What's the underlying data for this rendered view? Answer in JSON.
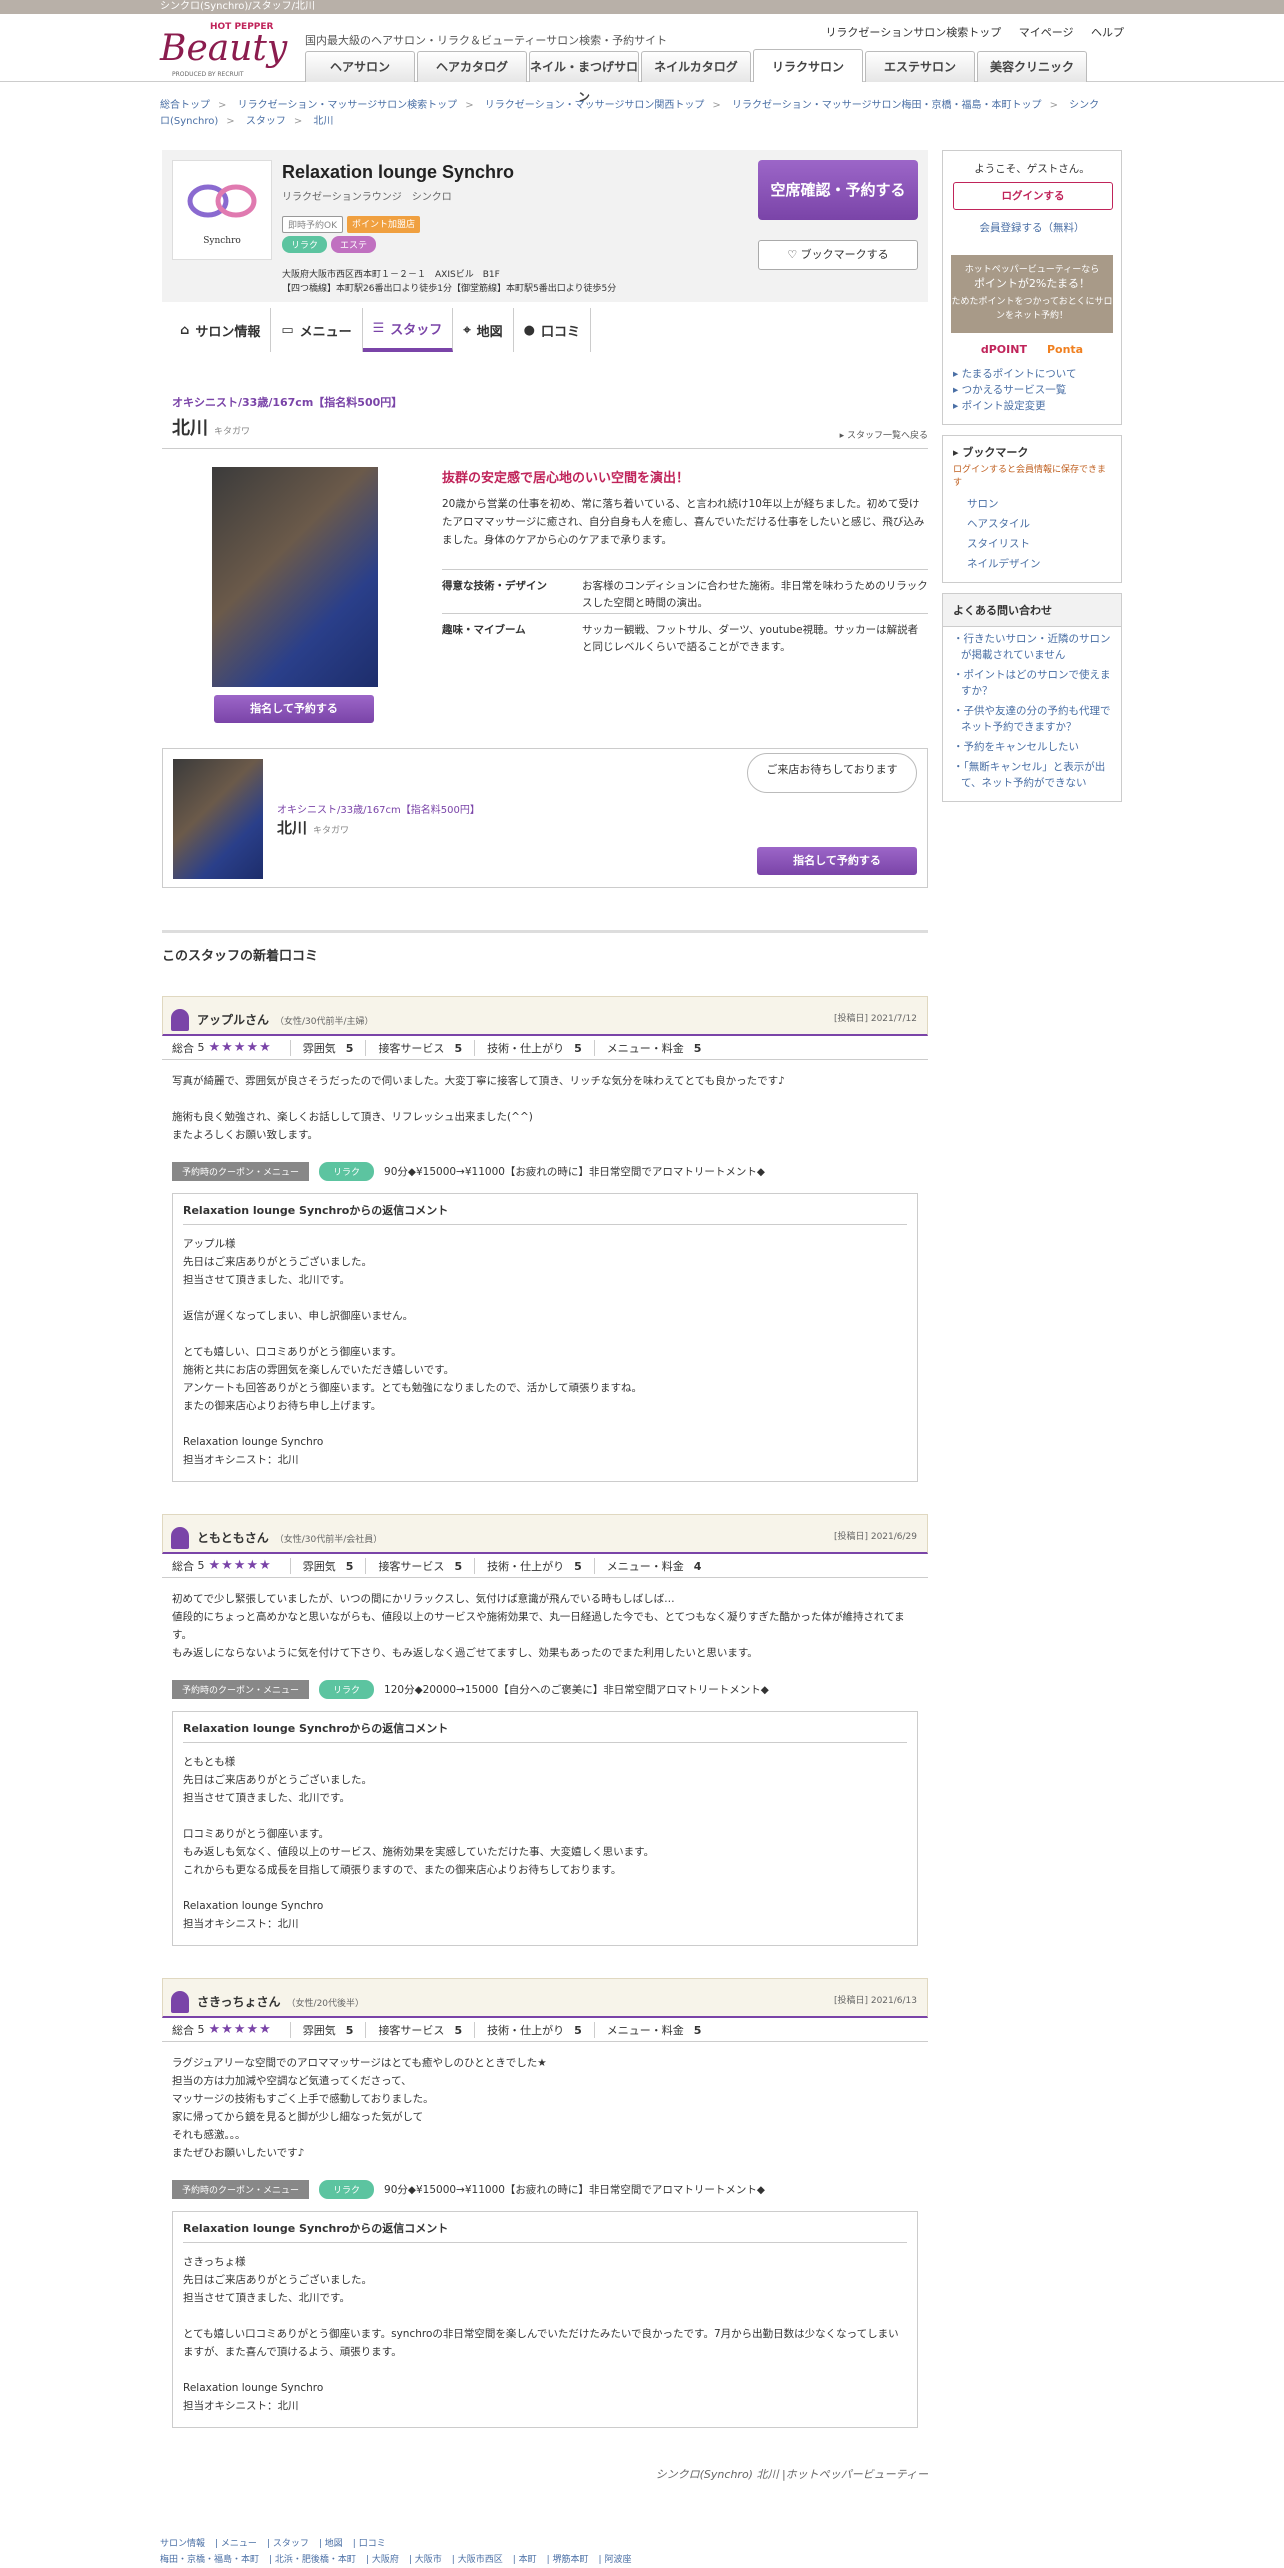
{
  "topstrip": "シンクロ(Synchro)/スタッフ/北川",
  "header": {
    "logo_hp": "HOT PEPPER",
    "logo_beauty": "Beauty",
    "logo_produced": "PRODUCED BY RECRUIT",
    "tagline": "国内最大級のヘアサロン・リラク＆ビューティーサロン検索・予約サイト",
    "links": [
      "リラクゼーションサロン検索トップ",
      "マイページ",
      "ヘルプ"
    ],
    "nav": [
      "ヘアサロン",
      "ヘアカタログ",
      "ネイル・まつげサロン",
      "ネイルカタログ",
      "リラクサロン",
      "エステサロン",
      "美容クリニック"
    ]
  },
  "breadcrumb": [
    "総合トップ",
    "リラクゼーション・マッサージサロン検索トップ",
    "リラクゼーション・マッサージサロン関西トップ",
    "リラクゼーション・マッサージサロン梅田・京橋・福島・本町トップ",
    "シンクロ(Synchro)",
    "スタッフ",
    "北川"
  ],
  "shop": {
    "name": "Relaxation lounge Synchro",
    "kana": "リラクゼーションラウンジ　シンクロ",
    "tags": [
      "即時予約OK",
      "ポイント加盟店",
      "リラク",
      "エステ"
    ],
    "addr1": "大阪府大阪市西区西本町１－２－１　AXISビル　B1F",
    "addr2": "【四つ橋線】本町駅26番出口より徒歩1分【御堂筋線】本町駅5番出口より徒歩5分",
    "reserve": "空席確認・予約する",
    "bookmark": "ブックマークする",
    "logo_text": "Synchro"
  },
  "tabs": [
    "サロン情報",
    "メニュー",
    "スタッフ",
    "地図",
    "口コミ"
  ],
  "staff": {
    "role": "オキシニスト/33歳/167cm【指名料500円】",
    "name": "北川",
    "kana": "キタガワ",
    "list_link": "スタッフ一覧へ戻る",
    "catch": "抜群の安定感で居心地のいい空間を演出！",
    "intro": "20歳から営業の仕事を初め、常に落ち着いている、と言われ続け10年以上が経ちました。初めて受けたアロママッサージに癒され、自分自身も人を癒し、喜んでいただける仕事をしたいと感じ、飛び込みました。身体のケアから心のケアまで承ります。",
    "spec1_label": "得意な技術・デザイン",
    "spec1": "お客様のコンディションに合わせた施術。非日常を味わうためのリラックスした空間と時間の演出。",
    "spec2_label": "趣味・マイブーム",
    "spec2": "サッカー観戦、フットサル、ダーツ、youtube視聴。サッカーは解説者と同じレベルくらいで語ることができます。",
    "btn": "指名して予約する",
    "bubble": "ご来店お待ちしております"
  },
  "reviews_title": "このスタッフの新着口コミ",
  "reviews": [
    {
      "name": "アップルさん",
      "meta": "（女性/30代前半/主婦）",
      "date": "[投稿日] 2021/7/12",
      "overall": "総合",
      "score": "5",
      "stars": "★★★★★",
      "r1": "雰囲気",
      "v1": "5",
      "r2": "接客サービス",
      "v2": "5",
      "r3": "技術・仕上がり",
      "v3": "5",
      "r4": "メニュー・料金",
      "v4": "5",
      "body": "写真が綺麗で、雰囲気が良さそうだったので伺いました。大変丁寧に接客して頂き、リッチな気分を味わえてとても良かったです♪\n\n施術も良く勉強され、楽しくお話しして頂き、リフレッシュ出来ました(^^)\nまたよろしくお願い致します。",
      "coupon_label": "予約時のクーポン・メニュー",
      "coupon_tag": "リラク",
      "coupon": "90分◆¥15000→¥11000【お疲れの時に】非日常空間でアロマトリートメント◆",
      "reply_title": "Relaxation lounge Synchroからの返信コメント",
      "reply": "アップル様\n先日はご来店ありがとうございました。\n担当させて頂きました、北川です。\n\n返信が遅くなってしまい、申し訳御座いません。\n\nとても嬉しい、口コミありがとう御座います。\n施術と共にお店の雰囲気を楽しんでいただき嬉しいです。\nアンケートも回答ありがとう御座います。とても勉強になりましたので、活かして頑張りますね。\nまたの御来店心よりお待ち申し上げます。\n\nRelaxation lounge Synchro\n担当オキシニスト：北川"
    },
    {
      "name": "ともともさん",
      "meta": "（女性/30代前半/会社員）",
      "date": "[投稿日] 2021/6/29",
      "overall": "総合",
      "score": "5",
      "stars": "★★★★★",
      "r1": "雰囲気",
      "v1": "5",
      "r2": "接客サービス",
      "v2": "5",
      "r3": "技術・仕上がり",
      "v3": "5",
      "r4": "メニュー・料金",
      "v4": "4",
      "body": "初めてで少し緊張していましたが、いつの間にかリラックスし、気付けば意識が飛んでいる時もしばしば…\n値段的にちょっと高めかなと思いながらも、値段以上のサービスや施術効果で、丸一日経過した今でも、とてつもなく凝りすぎた酷かった体が維持されてます。\nもみ返しにならないように気を付けて下さり、もみ返しなく過ごせてますし、効果もあったのでまた利用したいと思います。",
      "coupon_label": "予約時のクーポン・メニュー",
      "coupon_tag": "リラク",
      "coupon": "120分◆20000→15000【自分へのご褒美に】非日常空間アロマトリートメント◆",
      "reply_title": "Relaxation lounge Synchroからの返信コメント",
      "reply": "ともとも様\n先日はご来店ありがとうございました。\n担当させて頂きました、北川です。\n\n口コミありがとう御座います。\nもみ返しも気なく、値段以上のサービス、施術効果を実感していただけた事、大変嬉しく思います。\nこれからも更なる成長を目指して頑張りますので、またの御来店心よりお待ちしております。\n\nRelaxation lounge Synchro\n担当オキシニスト：北川"
    },
    {
      "name": "さきっちょさん",
      "meta": "（女性/20代後半）",
      "date": "[投稿日] 2021/6/13",
      "overall": "総合",
      "score": "5",
      "stars": "★★★★★",
      "r1": "雰囲気",
      "v1": "5",
      "r2": "接客サービス",
      "v2": "5",
      "r3": "技術・仕上がり",
      "v3": "5",
      "r4": "メニュー・料金",
      "v4": "5",
      "body": "ラグジュアリーな空間でのアロママッサージはとても癒やしのひとときでした★\n担当の方は力加減や空調など気遣ってくださって、\nマッサージの技術もすごく上手で感動しておりました。\n家に帰ってから鏡を見ると脚が少し細なった気がして\nそれも感激。。。\nまたぜひお願いしたいです♪",
      "coupon_label": "予約時のクーポン・メニュー",
      "coupon_tag": "リラク",
      "coupon": "90分◆¥15000→¥11000【お疲れの時に】非日常空間でアロマトリートメント◆",
      "reply_title": "Relaxation lounge Synchroからの返信コメント",
      "reply": "さきっちょ様\n先日はご来店ありがとうございました。\n担当させて頂きました、北川です。\n\nとても嬉しい口コミありがとう御座います。synchroの非日常空間を楽しんでいただけたみたいで良かったです。7月から出勤日数は少なくなってしまいますが、また喜んで頂けるよう、頑張ります。\n\nRelaxation lounge Synchro\n担当オキシニスト：北川"
    }
  ],
  "footer_meta": "シンクロ(Synchro) 北川 |ホットペッパービューティー",
  "footnav": [
    "サロン情報",
    "メニュー",
    "スタッフ",
    "地図",
    "口コミ"
  ],
  "footnav2": [
    "梅田・京橋・福島・本町",
    "北浜・肥後橋・本町",
    "大阪府",
    "大阪市",
    "大阪市西区",
    "本町",
    "堺筋本町",
    "阿波座"
  ],
  "sidebar": {
    "welcome": "ようこそ、ゲストさん。",
    "login": "ログインする",
    "register": "会員登録する（無料）",
    "points1": "ホットペッパービューティーなら",
    "points2": "ポイントが2%たまる！",
    "points3": "ためたポイントをつかっておとくにサロンをネット予約！",
    "dpoint": "dPOINT",
    "ponta": "Ponta",
    "links": [
      "たまるポイントについて",
      "つかえるサービス一覧",
      "ポイント設定変更"
    ],
    "bm_title": "ブックマーク",
    "bm_note": "ログインすると会員情報に保存できます",
    "bm_items": [
      "サロン",
      "ヘアスタイル",
      "スタイリスト",
      "ネイルデザイン"
    ],
    "faq_title": "よくある問い合わせ",
    "faq": [
      "行きたいサロン・近隣のサロンが掲載されていません",
      "ポイントはどのサロンで使えますか？",
      "子供や友達の分の予約も代理でネット予約できますか？",
      "予約をキャンセルしたい",
      "「無断キャンセル」と表示が出て、ネット予約ができない"
    ]
  }
}
